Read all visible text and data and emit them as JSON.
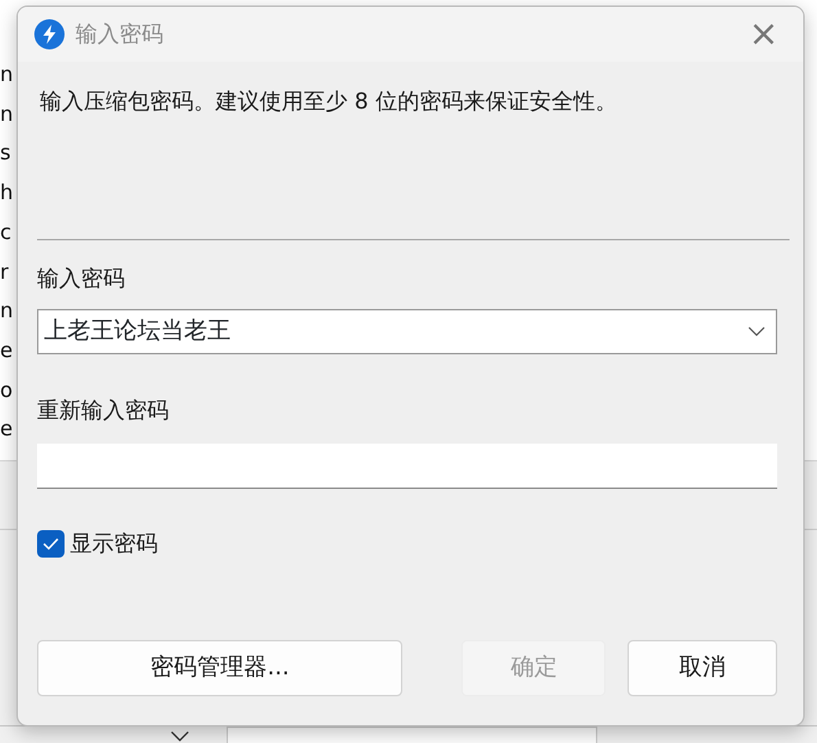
{
  "background": {
    "left_rows": [
      "n",
      "n",
      "s",
      "h",
      "c",
      "r",
      "n",
      "e",
      "o",
      "e"
    ]
  },
  "dialog": {
    "title": "输入密码",
    "close": "×",
    "description": "输入压缩包密码。建议使用至少 8 位的密码来保证安全性。",
    "password_label": "输入密码",
    "password": {
      "value": "上老王论坛当老王"
    },
    "confirm_label": "重新输入密码",
    "show_password": {
      "label": "显示密码",
      "checked": true
    },
    "buttons": [
      {
        "label": "密码管理器...",
        "kind": "manager",
        "disabled": false
      },
      {
        "label": "确定",
        "kind": "ok",
        "disabled": true
      },
      {
        "label": "取消",
        "kind": "cancel",
        "disabled": false
      }
    ]
  }
}
